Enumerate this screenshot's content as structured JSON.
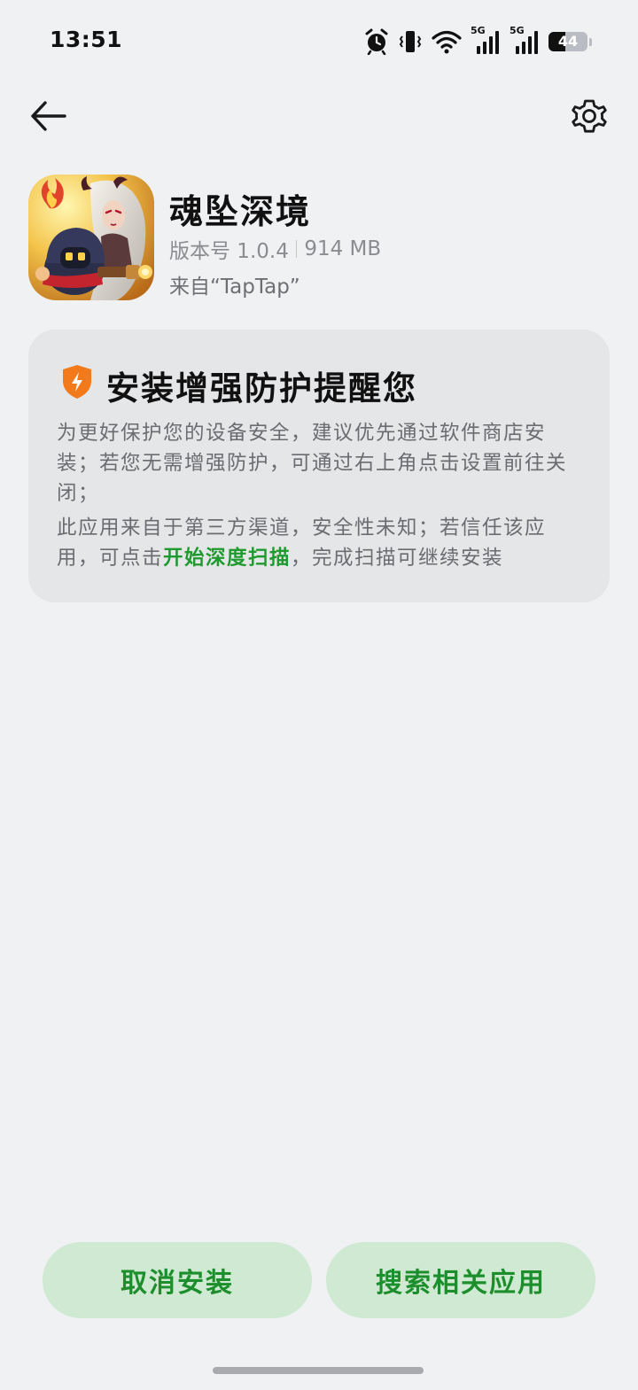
{
  "status_bar": {
    "time": "13:51",
    "signal_1_label": "5G",
    "signal_2_label": "5G",
    "battery_level": "44",
    "battery_fraction": 0.44
  },
  "nav": {
    "back_icon": "arrow-left-icon",
    "settings_icon": "gear-icon"
  },
  "app": {
    "name": "魂坠深境",
    "version": "版本号 1.0.4",
    "size": "914 MB",
    "source": "来自“TapTap”"
  },
  "warning": {
    "icon": "shield-icon",
    "title": "安装增强防护提醒您",
    "paragraph_1": "为更好保护您的设备安全，建议优先通过软件商店安装；若您无需增强防护，可通过右上角点击设置前往关闭；",
    "paragraph_2_before": "此应用来自于第三方渠道，安全性未知；若信任该应用，可点击",
    "scan_link": "开始深度扫描",
    "paragraph_2_after": "，完成扫描可继续安装"
  },
  "buttons": {
    "cancel_label": "取消安装",
    "search_label": "搜索相关应用"
  },
  "colors": {
    "accent_green": "#1f9a2e",
    "button_bg": "#cfe9d3",
    "shield_orange": "#f27a1a",
    "page_bg": "#f0f1f3",
    "card_bg": "#e5e6e8"
  }
}
